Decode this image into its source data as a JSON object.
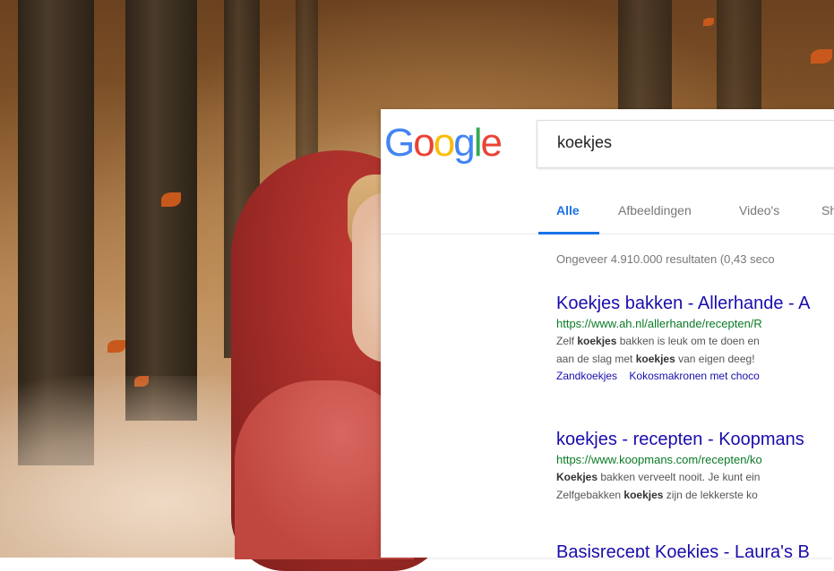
{
  "logo": {
    "letters": [
      {
        "char": "G",
        "color": "#4285F4"
      },
      {
        "char": "o",
        "color": "#EA4335"
      },
      {
        "char": "o",
        "color": "#FBBC05"
      },
      {
        "char": "g",
        "color": "#4285F4"
      },
      {
        "char": "l",
        "color": "#34A853"
      },
      {
        "char": "e",
        "color": "#EA4335"
      }
    ]
  },
  "search": {
    "query": "koekjes"
  },
  "tabs": [
    {
      "label": "Alle",
      "active": true
    },
    {
      "label": "Afbeeldingen",
      "active": false
    },
    {
      "label": "Video's",
      "active": false
    },
    {
      "label": "Sh",
      "active": false
    }
  ],
  "stats": "Ongeveer 4.910.000 resultaten (0,43 seco",
  "results": [
    {
      "title": "Koekjes bakken - Allerhande - A",
      "url": "https://www.ah.nl/allerhande/recepten/R",
      "snippet1_pre": "Zelf ",
      "snippet1_bold": "koekjes",
      "snippet1_post": " bakken is leuk om te doen en",
      "snippet2_pre": "aan de slag met ",
      "snippet2_bold": "koekjes",
      "snippet2_post": " van eigen deeg! ",
      "links": [
        "Zandkoekjes",
        "Kokosmakronen met choco"
      ]
    },
    {
      "title": "koekjes - recepten - Koopmans",
      "url": "https://www.koopmans.com/recepten/ko",
      "snippet1_pre": "",
      "snippet1_bold": "Koekjes",
      "snippet1_post": " bakken verveelt nooit. Je kunt ein",
      "snippet2_pre": "Zelfgebakken ",
      "snippet2_bold": "koekjes",
      "snippet2_post": " zijn de lekkerste ko"
    },
    {
      "title": "Basisrecept Koekjes - Laura's B"
    }
  ],
  "colors": {
    "link_blue": "#1a0dab",
    "url_green": "#0b7a26",
    "tab_active": "#1a73e8"
  }
}
